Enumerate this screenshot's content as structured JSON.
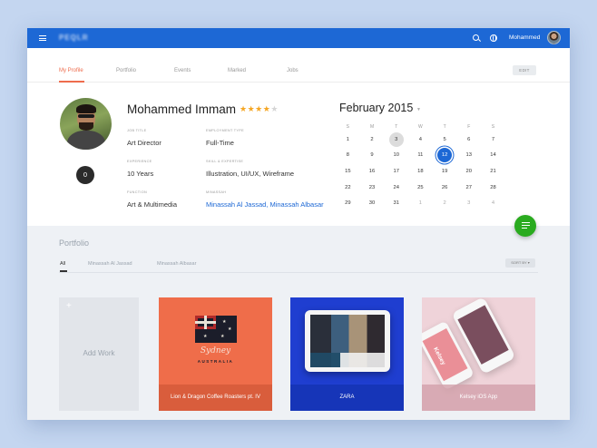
{
  "topbar": {
    "logo_text": "PEQLR",
    "username": "Mohammed",
    "icons": [
      "menu-icon",
      "search-icon",
      "globe-icon",
      "avatar"
    ]
  },
  "tabs": [
    {
      "label": "My Profile",
      "active": true
    },
    {
      "label": "Portfolio",
      "active": false
    },
    {
      "label": "Events",
      "active": false
    },
    {
      "label": "Marked",
      "active": false
    },
    {
      "label": "Jobs",
      "active": false
    }
  ],
  "edit_label": "EDIT",
  "profile": {
    "name": "Mohammed Immam",
    "rating": 4,
    "rating_max": 5,
    "count": "0",
    "fields": [
      {
        "label": "JOB TITLE",
        "value": "Art Director"
      },
      {
        "label": "EMPLOYMENT TYPE",
        "value": "Full-Time"
      },
      {
        "label": "EXPERIENCE",
        "value": "10 Years"
      },
      {
        "label": "SKILL & EXPERTISE",
        "value": "Illustration, UI/UX, Wireframe"
      },
      {
        "label": "FUNCTION",
        "value": "Art & Multimedia"
      },
      {
        "label": "MINASSAH",
        "value": "Minassah Al Jassad, Minassah Albasar"
      }
    ]
  },
  "calendar": {
    "title": "February 2015",
    "weekdays": [
      "S",
      "M",
      "T",
      "W",
      "T",
      "F",
      "S"
    ],
    "today": "3",
    "selected": "12",
    "weeks": [
      [
        "1",
        "2",
        "3",
        "4",
        "5",
        "6",
        "7"
      ],
      [
        "8",
        "9",
        "10",
        "11",
        "12",
        "13",
        "14"
      ],
      [
        "15",
        "16",
        "17",
        "18",
        "19",
        "20",
        "21"
      ],
      [
        "22",
        "23",
        "24",
        "25",
        "26",
        "27",
        "28"
      ],
      [
        "29",
        "30",
        "31",
        "1",
        "2",
        "3",
        "4"
      ]
    ],
    "muted_from_week": 4,
    "muted_from_day": 3
  },
  "portfolio": {
    "title": "Portfolio",
    "filters": [
      {
        "label": "All",
        "active": true
      },
      {
        "label": "Minassah Al Jassad",
        "active": false
      },
      {
        "label": "Minassah Albasar",
        "active": false
      }
    ],
    "sort_label": "SORT BY",
    "add_label": "Add Work",
    "items": [
      {
        "caption": "Lion & Dragon Coffee Roasters pt. IV",
        "script_text": "Sydney",
        "sub_text": "AUSTRALIA"
      },
      {
        "caption": "ZARA"
      },
      {
        "caption": "Kelsey iOS App",
        "phone_text": "Kelsey"
      }
    ]
  },
  "colors": {
    "brand_blue": "#1d68d5",
    "accent_orange": "#ee6c4d",
    "fab_green": "#2aab1f",
    "star_gold": "#f5a623"
  }
}
